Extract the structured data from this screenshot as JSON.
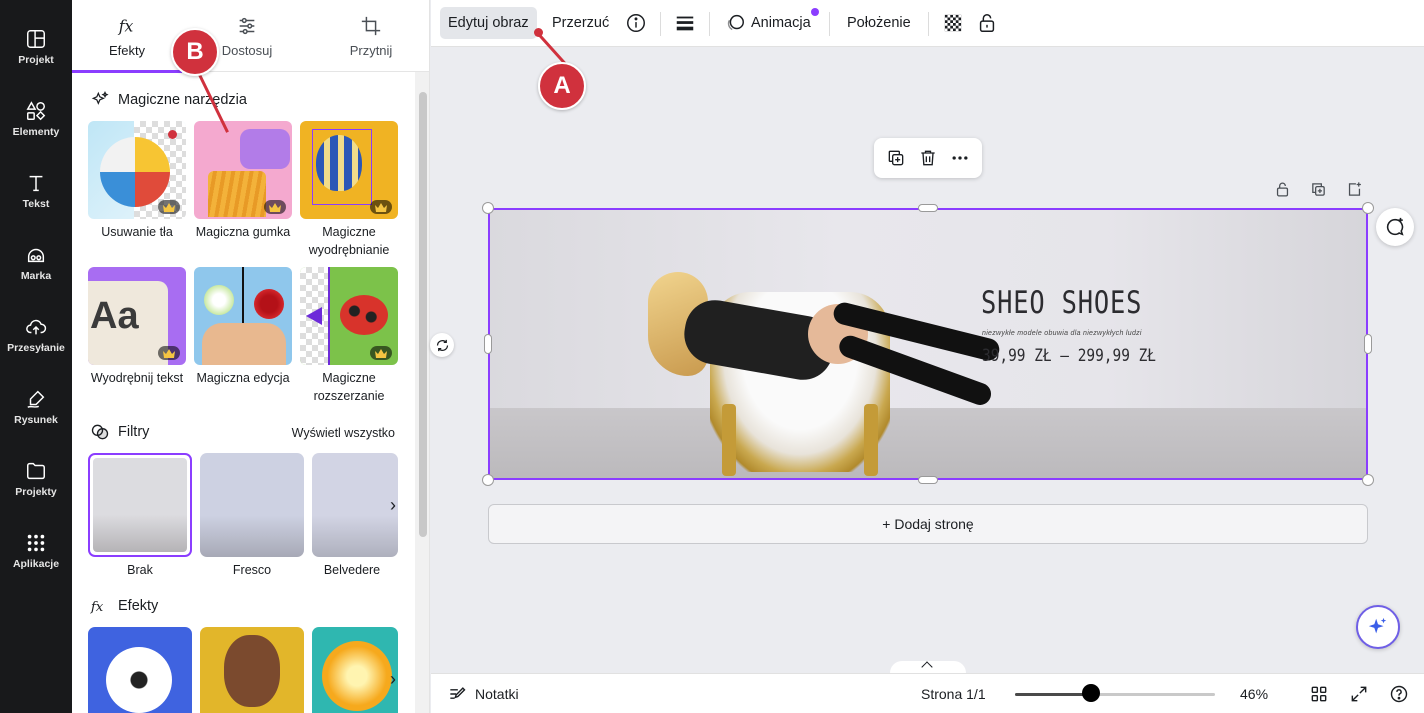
{
  "rail": {
    "items": [
      {
        "label": "Projekt",
        "icon": "layout-icon"
      },
      {
        "label": "Elementy",
        "icon": "shapes-icon"
      },
      {
        "label": "Tekst",
        "icon": "text-icon"
      },
      {
        "label": "Marka",
        "icon": "brand-icon"
      },
      {
        "label": "Przesyłanie",
        "icon": "upload-cloud-icon"
      },
      {
        "label": "Rysunek",
        "icon": "draw-icon"
      },
      {
        "label": "Projekty",
        "icon": "folder-icon"
      },
      {
        "label": "Aplikacje",
        "icon": "apps-grid-icon"
      }
    ]
  },
  "panel": {
    "tabs": [
      {
        "label": "Efekty",
        "icon": "fx-icon",
        "active": true
      },
      {
        "label": "Dostosuj",
        "icon": "sliders-icon"
      },
      {
        "label": "Przytnij",
        "icon": "crop-icon"
      }
    ],
    "magic": {
      "title": "Magiczne narzędzia",
      "tools": [
        {
          "label": "Usuwanie tła"
        },
        {
          "label": "Magiczna gumka"
        },
        {
          "label": "Magiczne wyodrębnianie"
        },
        {
          "label": "Wyodrębnij tekst"
        },
        {
          "label": "Magiczna edycja"
        },
        {
          "label": "Magiczne rozszerzanie"
        }
      ]
    },
    "filters": {
      "title": "Filtry",
      "see_all": "Wyświetl wszystko",
      "items": [
        {
          "label": "Brak"
        },
        {
          "label": "Fresco"
        },
        {
          "label": "Belvedere"
        }
      ]
    },
    "effects": {
      "title": "Efekty"
    }
  },
  "toolbar": {
    "edit_image": "Edytuj obraz",
    "flip": "Przerzuć",
    "animation": "Animacja",
    "position": "Położenie"
  },
  "design": {
    "brand": "SHEO SHOES",
    "tagline": "niezwykłe modele obuwia dla niezwykłych ludzi",
    "price": "39,99 ZŁ  –  299,99 ZŁ"
  },
  "canvas": {
    "add_page": "+ Dodaj stronę"
  },
  "footer": {
    "notes": "Notatki",
    "page": "Strona 1/1",
    "zoom_label": "46%",
    "zoom_fraction": 0.38
  },
  "callouts": {
    "a": "A",
    "b": "B"
  },
  "colors": {
    "accent": "#8b3dff",
    "callout": "#d0313d",
    "rail": "#18191b"
  }
}
